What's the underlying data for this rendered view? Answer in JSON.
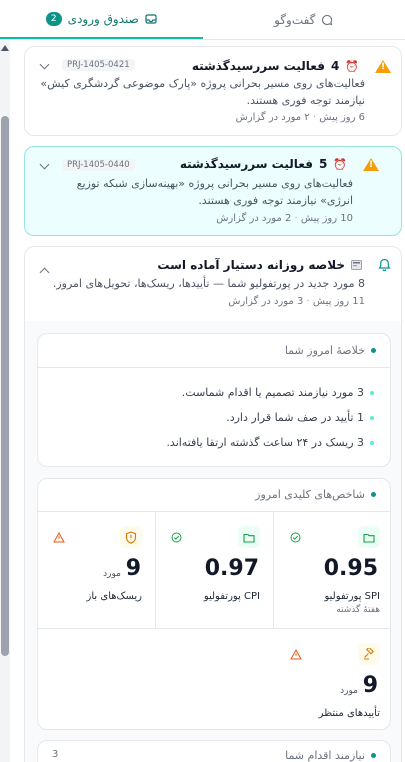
{
  "tabs": [
    {
      "label": "گفت‌وگو",
      "icon": "chat-bubble-icon"
    },
    {
      "label": "صندوق ورودی",
      "icon": "inbox-icon",
      "count": "2"
    }
  ],
  "cards": [
    {
      "title_prefix": "4",
      "title": "فعالیت سررسیدگذشته",
      "project": "PRJ-1405-0421",
      "desc1": "فعالیت‌های روی مسیر بحرانی پروژه «پارک موضوعی گردشگری کیش»",
      "desc2": "نیازمند توجه فوری هستند.",
      "age": "6 روز پیش",
      "count": "۲ مورد در گزارش"
    },
    {
      "title_prefix": "5",
      "title": "فعالیت سررسیدگذشته",
      "project": "PRJ-1405-0440",
      "desc1": "فعالیت‌های روی مسیر بحرانی پروژه «بهینه‌سازی شبکه توزیع",
      "desc2": "انرژی» نیازمند توجه فوری هستند.",
      "age": "10 روز پیش",
      "count": "2 مورد در گزارش"
    },
    {
      "title": "خلاصه روزانه دستیار آماده است",
      "desc1": "8 مورد جدید در پورتفولیو شما — تأییدها، ریسک‌ها، تحویل‌های امروز.",
      "age": "11 روز پیش",
      "count": "3 مورد در گزارش"
    }
  ],
  "summary": {
    "heading": "خلاصهٔ امروز شما",
    "bullets": [
      "3 مورد نیازمند تصمیم یا اقدام شماست.",
      "1 تأیید در صف شما قرار دارد.",
      "3 ریسک در ۲۴ ساعت گذشته ارتقا یافته‌اند."
    ]
  },
  "kpis": {
    "heading": "شاخص‌های کلیدی امروز",
    "items": [
      {
        "value": "0.95",
        "label": "SPI پورتفولیو",
        "sub": "هفتهٔ گذشته",
        "icon": "folder-icon",
        "status": "check-circle-icon"
      },
      {
        "value": "0.97",
        "label": "CPI پورتفولیو",
        "icon": "folder-icon",
        "status": "check-circle-icon"
      },
      {
        "value": "9",
        "unit": "مورد",
        "label": "ریسک‌های باز",
        "icon": "shield-alert-icon",
        "status": "warning-icon"
      },
      {
        "value": "9",
        "unit": "مورد",
        "label": "تأییدهای منتظر",
        "icon": "gavel-icon",
        "status": "warning-icon"
      }
    ]
  },
  "action": {
    "heading": "نیازمند اقدام شما",
    "count": "3"
  },
  "colors": {
    "accent": "#0d9488",
    "warning": "#f59e0b",
    "selected_bg": "#ecfeff"
  }
}
